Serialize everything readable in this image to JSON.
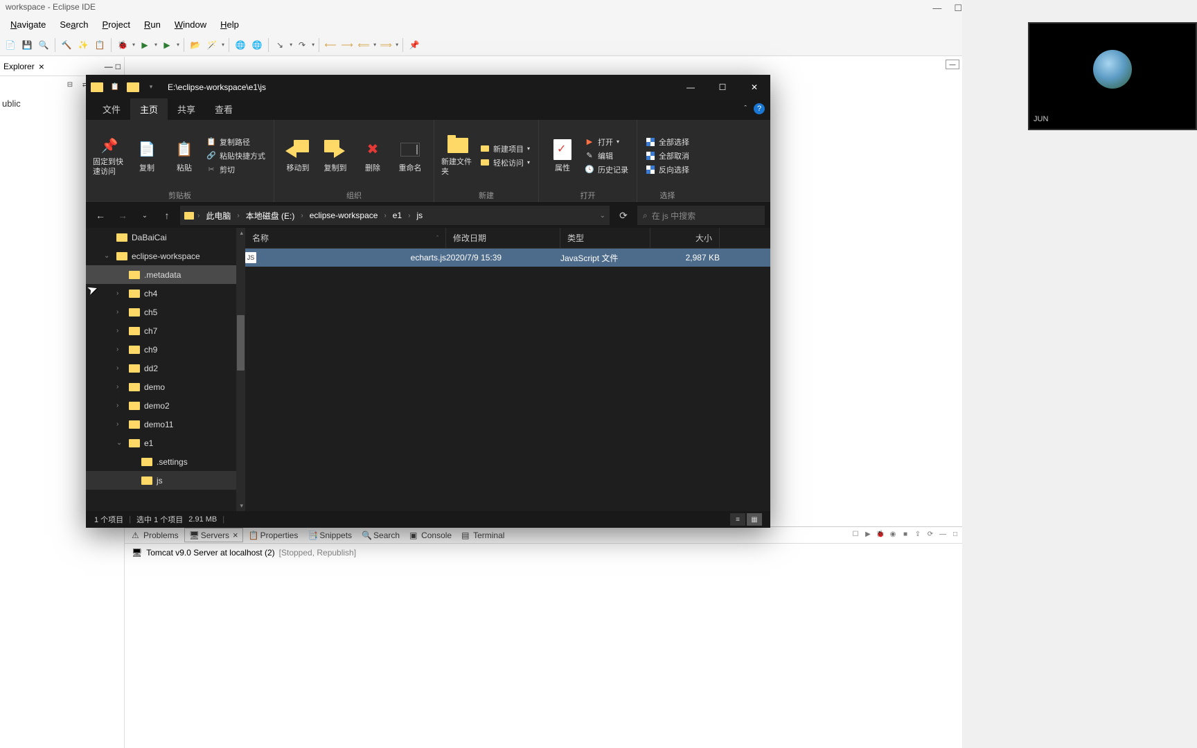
{
  "eclipse": {
    "title": "workspace - Eclipse IDE",
    "menu": [
      "Navigate",
      "Search",
      "Project",
      "Run",
      "Window",
      "Help"
    ],
    "explorer_tab": "Explorer",
    "tree_item": "ublic",
    "bottom_tabs": {
      "problems": "Problems",
      "servers": "Servers",
      "properties": "Properties",
      "snippets": "Snippets",
      "search": "Search",
      "console": "Console",
      "terminal": "Terminal"
    },
    "tomcat": {
      "name": "Tomcat v9.0 Server at localhost (2)",
      "status": "[Stopped, Republish]"
    }
  },
  "file_explorer": {
    "title_path": "E:\\eclipse-workspace\\e1\\js",
    "tabs": {
      "file": "文件",
      "home": "主页",
      "share": "共享",
      "view": "查看"
    },
    "ribbon": {
      "pin": "固定到快速访问",
      "copy": "复制",
      "paste": "粘贴",
      "copy_path": "复制路径",
      "paste_shortcut": "粘贴快捷方式",
      "cut": "剪切",
      "clipboard_group": "剪贴板",
      "move_to": "移动到",
      "copy_to": "复制到",
      "delete": "删除",
      "rename": "重命名",
      "organize_group": "组织",
      "new_item": "新建项目",
      "easy_access": "轻松访问",
      "new_folder": "新建文件夹",
      "new_group": "新建",
      "properties": "属性",
      "open": "打开",
      "edit": "编辑",
      "history": "历史记录",
      "open_group": "打开",
      "select_all": "全部选择",
      "select_none": "全部取消",
      "invert": "反向选择",
      "select_group": "选择"
    },
    "breadcrumb": {
      "pc": "此电脑",
      "drive": "本地磁盘 (E:)",
      "ws": "eclipse-workspace",
      "e1": "e1",
      "js": "js"
    },
    "search_placeholder": "在 js 中搜索",
    "tree": [
      {
        "name": "DaBaiCai",
        "indent": 1,
        "expandable": false
      },
      {
        "name": "eclipse-workspace",
        "indent": 1,
        "expanded": true
      },
      {
        "name": ".metadata",
        "indent": 2,
        "selected": true
      },
      {
        "name": "ch4",
        "indent": 2,
        "expandable": true
      },
      {
        "name": "ch5",
        "indent": 2,
        "expandable": true
      },
      {
        "name": "ch7",
        "indent": 2,
        "expandable": true
      },
      {
        "name": "ch9",
        "indent": 2,
        "expandable": true
      },
      {
        "name": "dd2",
        "indent": 2,
        "expandable": true
      },
      {
        "name": "demo",
        "indent": 2,
        "expandable": true
      },
      {
        "name": "demo2",
        "indent": 2,
        "expandable": true
      },
      {
        "name": "demo11",
        "indent": 2,
        "expandable": true
      },
      {
        "name": "e1",
        "indent": 2,
        "expanded": true
      },
      {
        "name": ".settings",
        "indent": 3
      },
      {
        "name": "js",
        "indent": 3,
        "selected_sub": true
      }
    ],
    "columns": {
      "name": "名称",
      "date": "修改日期",
      "type": "类型",
      "size": "大小"
    },
    "files": [
      {
        "name": "echarts.js",
        "date": "2020/7/9 15:39",
        "type": "JavaScript 文件",
        "size": "2,987 KB",
        "selected": true
      }
    ],
    "status": {
      "count": "1 个项目",
      "selected": "选中 1 个项目",
      "size": "2.91 MB"
    }
  },
  "camera": {
    "label": "JUN"
  }
}
